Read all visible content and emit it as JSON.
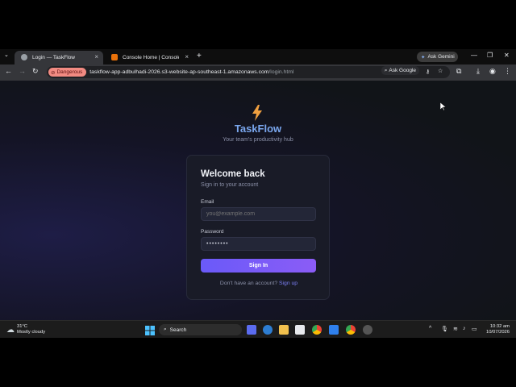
{
  "browser": {
    "tabs": [
      {
        "title": "Login — TaskFlow",
        "active": true
      },
      {
        "title": "Console Home | Console Home",
        "active": false
      }
    ],
    "new_tab": "+",
    "ask_gemini": "Ask Gemini",
    "security_chip": "Dangerous",
    "url_host": "taskflow-app-adbulhadi-2026.s3-website-ap-southeast-1.amazonaws.com",
    "url_path": "/login.html",
    "ask_google": "Ask Google"
  },
  "page": {
    "brand": "TaskFlow",
    "tagline": "Your team's productivity hub",
    "card": {
      "title": "Welcome back",
      "subtitle": "Sign in to your account",
      "email_label": "Email",
      "email_placeholder": "you@example.com",
      "password_label": "Password",
      "password_value": "••••••••",
      "submit_label": "Sign In",
      "footer_text": "Don't have an account?",
      "signup_link": "Sign up"
    },
    "colors": {
      "accent": "#7b7ff5",
      "brand": "#7aa7ee",
      "button": "#7c5cf7",
      "bolt": "#f0a040"
    }
  },
  "taskbar": {
    "weather_temp": "31°C",
    "weather_desc": "Mostly cloudy",
    "search_label": "Search",
    "time": "10:32 am",
    "date": "10/07/2026"
  }
}
